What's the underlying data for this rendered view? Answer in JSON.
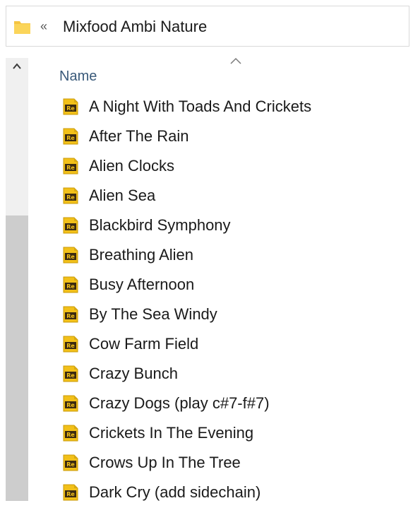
{
  "breadcrumb": {
    "separator": "«",
    "current": "Mixfood Ambi Nature",
    "icon": "folder-icon"
  },
  "column_header": {
    "name": "Name",
    "sort": "ascending"
  },
  "file_icon": "reason-file-icon",
  "colors": {
    "icon_yellow": "#f2c019",
    "icon_dark": "#3b2a10",
    "header_text": "#3a5a7a",
    "scroll_thumb": "#cdcdcd",
    "scroll_track": "#f0f0f0"
  },
  "files": [
    {
      "name": "A Night With Toads And Crickets"
    },
    {
      "name": "After The Rain"
    },
    {
      "name": "Alien Clocks"
    },
    {
      "name": "Alien Sea"
    },
    {
      "name": "Blackbird Symphony"
    },
    {
      "name": "Breathing Alien"
    },
    {
      "name": "Busy Afternoon"
    },
    {
      "name": "By The Sea Windy"
    },
    {
      "name": "Cow Farm Field"
    },
    {
      "name": "Crazy Bunch"
    },
    {
      "name": "Crazy Dogs (play c#7-f#7)"
    },
    {
      "name": "Crickets In The Evening"
    },
    {
      "name": "Crows Up In The Tree"
    },
    {
      "name": "Dark Cry (add sidechain)"
    }
  ]
}
